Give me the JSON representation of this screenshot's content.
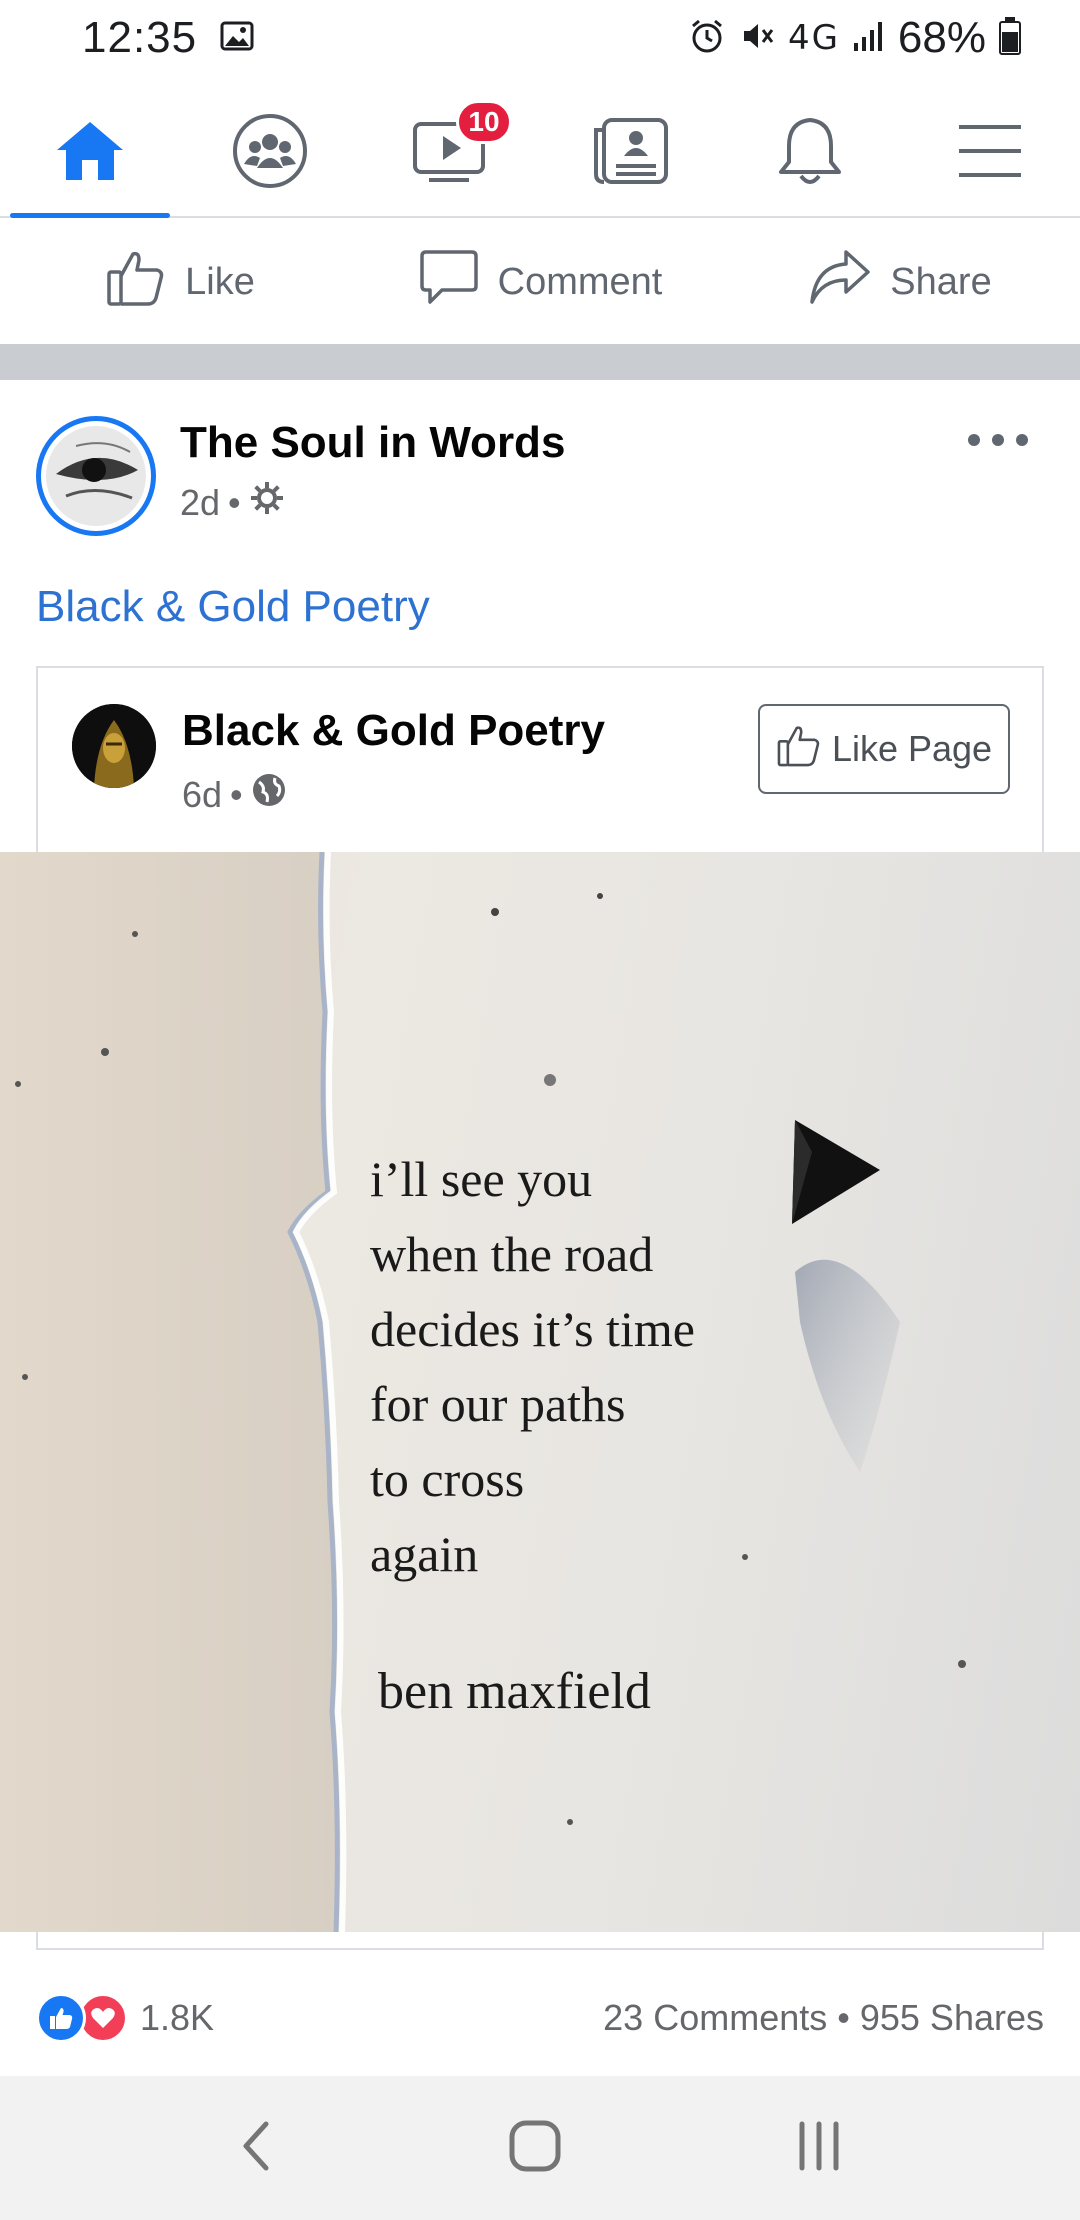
{
  "status_bar": {
    "time": "12:35",
    "battery": "68%",
    "network": "4G",
    "icons": [
      "image-icon",
      "alarm-icon",
      "mute-icon",
      "network-icon",
      "signal-icon",
      "battery-icon"
    ]
  },
  "top_nav": {
    "tabs": [
      {
        "name": "home",
        "icon": "home-icon",
        "active": true
      },
      {
        "name": "groups",
        "icon": "groups-icon",
        "active": false
      },
      {
        "name": "watch",
        "icon": "video-icon",
        "badge": "10",
        "active": false
      },
      {
        "name": "news",
        "icon": "news-icon",
        "active": false
      },
      {
        "name": "notifications",
        "icon": "bell-icon",
        "active": false
      },
      {
        "name": "menu",
        "icon": "menu-icon",
        "active": false
      }
    ]
  },
  "actions": {
    "like": "Like",
    "comment": "Comment",
    "share": "Share"
  },
  "post": {
    "author": "The Soul in Words",
    "time": "2d",
    "visibility_icon": "gear-icon",
    "group_link": "Black & Gold Poetry",
    "shared": {
      "author": "Black & Gold Poetry",
      "time": "6d",
      "visibility_icon": "globe-icon",
      "like_page": "Like Page"
    },
    "image": {
      "poem_lines": [
        "i’ll see you",
        "when the road",
        "decides it’s time",
        "for our paths",
        "to cross",
        "again"
      ],
      "poem_author": "ben maxfield"
    },
    "reactions": {
      "count": "1.8K",
      "comments": "23 Comments",
      "separator": "•",
      "shares": "955 Shares"
    }
  },
  "colors": {
    "accent": "#1877f2",
    "badge": "#e41e3f",
    "link": "#2d72d2",
    "love": "#f33e58"
  }
}
